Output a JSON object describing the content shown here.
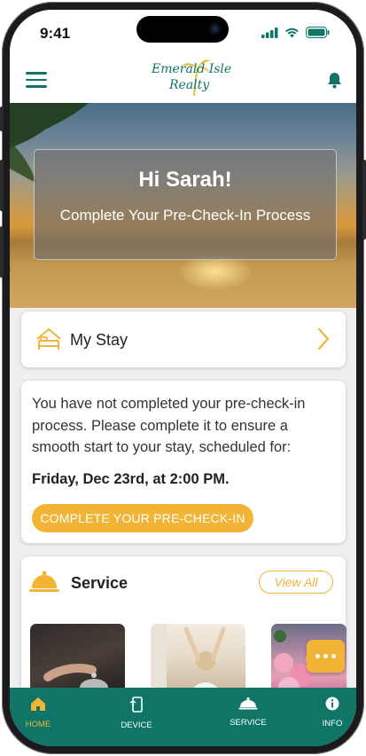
{
  "status_bar": {
    "time": "9:41"
  },
  "app": {
    "logo_line1": "Emerald Isle",
    "logo_line2": "Realty"
  },
  "hero": {
    "greeting": "Hi Sarah!",
    "subtitle": "Complete Your Pre-Check-In Process"
  },
  "my_stay": {
    "label": "My Stay"
  },
  "notice": {
    "message": "You have not completed your pre-check-in process. Please complete it to ensure a smooth start to your stay, scheduled for:",
    "date": "Friday, Dec 23rd, at 2:00 PM.",
    "button_label": "COMPLETE YOUR PRE-CHECK-IN"
  },
  "service": {
    "title": "Service",
    "view_all": "View All"
  },
  "colors": {
    "brand_teal": "#0f7566",
    "accent_gold": "#f2b437"
  },
  "bottom_nav": [
    {
      "label": "HOME",
      "icon": "home-icon",
      "active": true
    },
    {
      "label": "DEVICE",
      "icon": "device-icon",
      "active": false
    },
    {
      "label": "SERVICE",
      "icon": "service-bell-icon",
      "active": false
    },
    {
      "label": "INFO",
      "icon": "info-icon",
      "active": false
    }
  ]
}
